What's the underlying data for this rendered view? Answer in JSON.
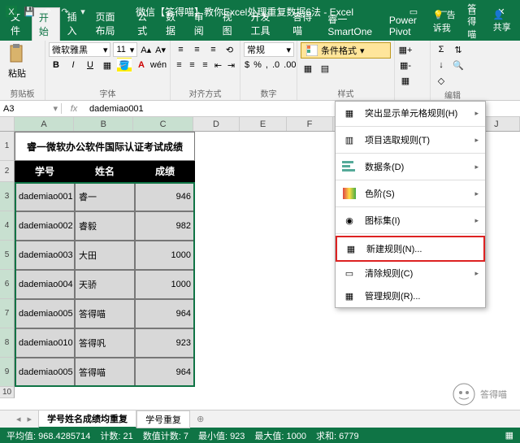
{
  "titlebar": {
    "title": "微信【答得喵】教你Excel处理重复数据6法 - Excel"
  },
  "tabs": {
    "items": [
      "文件",
      "开始",
      "插入",
      "页面布局",
      "公式",
      "数据",
      "审阅",
      "视图",
      "开发工具",
      "答得喵",
      "睿一 SmartOne",
      "Power Pivot"
    ],
    "active": 1,
    "tellme": "告诉我",
    "answer": "答得喵",
    "share": "共享"
  },
  "ribbon": {
    "clipboard": {
      "paste": "粘贴",
      "label": "剪贴板"
    },
    "font": {
      "name": "微软雅黑",
      "size": "11",
      "label": "字体"
    },
    "align": {
      "label": "对齐方式"
    },
    "number": {
      "format": "常规",
      "label": "数字"
    },
    "condfmt": {
      "label": "条件格式"
    },
    "styles": {
      "label": "样式"
    },
    "edit": {
      "label": "编辑"
    }
  },
  "condmenu": {
    "items": [
      {
        "label": "突出显示单元格规则(H)",
        "sub": true
      },
      {
        "label": "项目选取规则(T)",
        "sub": true
      },
      {
        "label": "数据条(D)",
        "sub": true
      },
      {
        "label": "色阶(S)",
        "sub": true
      },
      {
        "label": "图标集(I)",
        "sub": true
      },
      {
        "label": "新建规则(N)...",
        "hi": true
      },
      {
        "label": "清除规则(C)",
        "sub": true
      },
      {
        "label": "管理规则(R)..."
      }
    ]
  },
  "namebox": {
    "ref": "A3",
    "value": "dademiao001"
  },
  "chart_data": {
    "type": "table",
    "title": "睿一微软办公软件国际认证考试成绩",
    "columns": [
      "学号",
      "姓名",
      "成绩"
    ],
    "rows": [
      [
        "dademiao001",
        "睿一",
        946
      ],
      [
        "dademiao002",
        "睿毅",
        982
      ],
      [
        "dademiao003",
        "大田",
        1000
      ],
      [
        "dademiao004",
        "天骄",
        1000
      ],
      [
        "dademiao005",
        "答得喵",
        964
      ],
      [
        "dademiao010",
        "答得㕨",
        923
      ],
      [
        "dademiao005",
        "答得喵",
        964
      ]
    ]
  },
  "colheaders": [
    "A",
    "B",
    "C",
    "D",
    "E",
    "F",
    "G",
    "H",
    "I",
    "J"
  ],
  "sheettabs": {
    "tabs": [
      "学号姓名成绩均重复",
      "学号重复"
    ],
    "active": 0
  },
  "status": {
    "avg": "平均值: 968.4285714",
    "count": "计数: 21",
    "numcount": "数值计数: 7",
    "min": "最小值: 923",
    "max": "最大值: 1000",
    "sum": "求和: 6779"
  },
  "watermark": "答得喵"
}
